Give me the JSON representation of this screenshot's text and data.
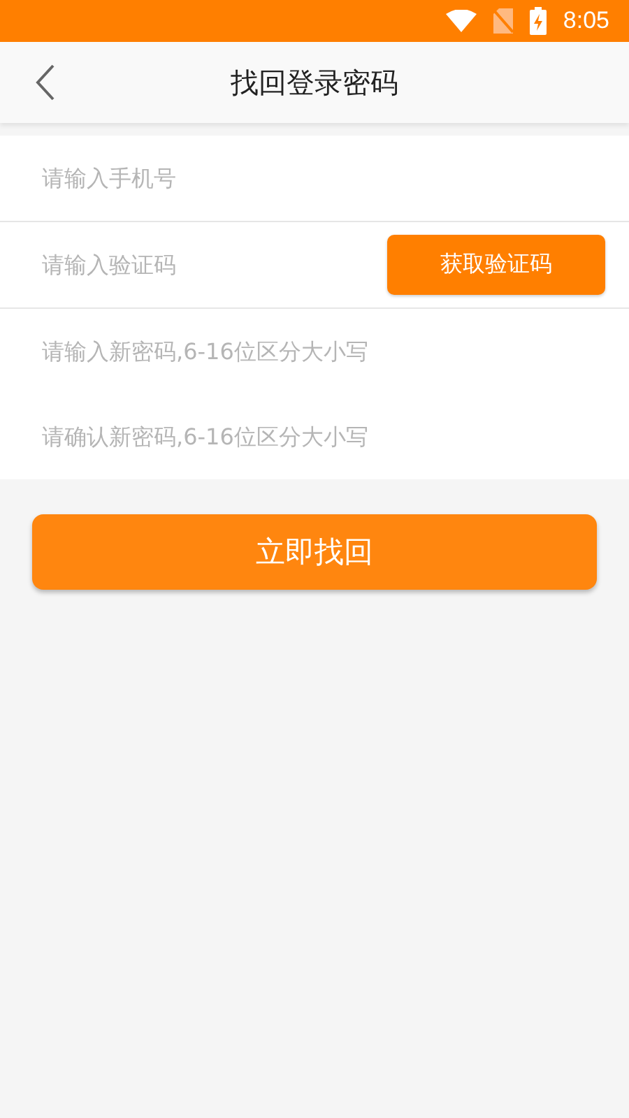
{
  "status_bar": {
    "time": "8:05"
  },
  "header": {
    "title": "找回登录密码"
  },
  "fields": [
    {
      "kind": "plain",
      "placeholder": "请输入手机号"
    },
    {
      "kind": "with-button",
      "placeholder": "请输入验证码",
      "button": "获取验证码"
    },
    {
      "kind": "plain",
      "placeholder": "请输入新密码,6-16位区分大小写"
    },
    {
      "kind": "plain",
      "placeholder": "请确认新密码,6-16位区分大小写"
    }
  ],
  "submit_button": "立即找回"
}
